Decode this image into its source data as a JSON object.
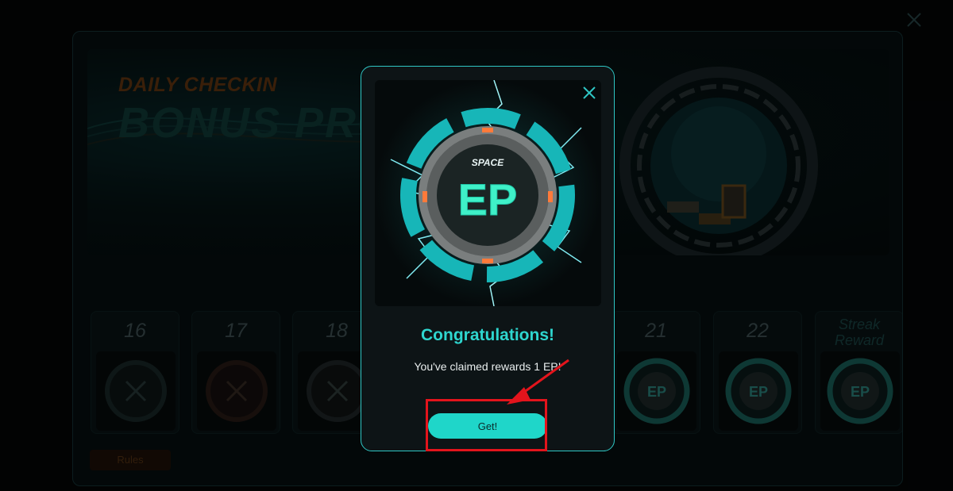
{
  "banner": {
    "subtitle": "DAILY CHECKIN",
    "title": "BONUS PROG"
  },
  "days": [
    {
      "label": "16",
      "state": "missed"
    },
    {
      "label": "17",
      "state": "missed"
    },
    {
      "label": "18",
      "state": "missed"
    },
    {
      "label": "21",
      "state": "upcoming"
    },
    {
      "label": "22",
      "state": "upcoming"
    },
    {
      "label": "Streak Reward",
      "state": "upcoming"
    }
  ],
  "rules_label": "Rules",
  "modal": {
    "coin_brand": "SPACE",
    "coin_text": "EP",
    "heading": "Congratulations!",
    "message": "You've claimed rewards 1 EP!",
    "button_label": "Get!"
  },
  "colors": {
    "accent": "#1fd6c9",
    "heading": "#2ed6cf",
    "annotation": "#e3141c"
  }
}
